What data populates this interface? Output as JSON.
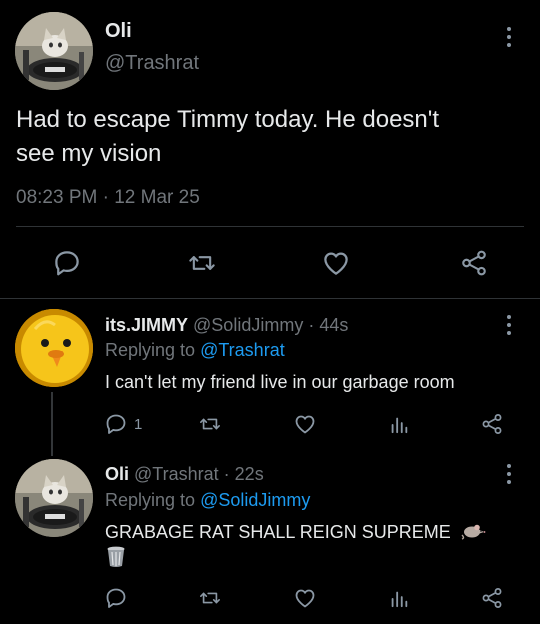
{
  "main_tweet": {
    "name": "Oli",
    "handle": "@Trashrat",
    "text_line1": "Had to escape Timmy today. He doesn't",
    "text_line2": "see my vision",
    "timestamp": "08:23 PM · 12 Mar 25",
    "actions": [
      "reply-icon",
      "retweet-icon",
      "like-icon",
      "share-icon"
    ]
  },
  "replies": [
    {
      "name": "its.JIMMY",
      "handle": "@SolidJimmy",
      "time": "· 44s",
      "replying_prefix": "Replying to",
      "replying_to": "@Trashrat",
      "text": "I can't let my friend live in our garbage room",
      "reply_count": "1"
    },
    {
      "name": "Oli",
      "handle": "@Trashrat",
      "time": "· 22s",
      "replying_prefix": "Replying to",
      "replying_to": "@SolidJimmy",
      "text": "GRABAGE RAT SHALL REIGN SUPREME",
      "emojis": [
        "rat-emoji",
        "wastebasket-emoji"
      ]
    }
  ],
  "colors": {
    "background": "#000000",
    "text": "#e7e9ea",
    "secondary": "#71767b",
    "link": "#1d9bf0",
    "divider": "#2f3336"
  }
}
